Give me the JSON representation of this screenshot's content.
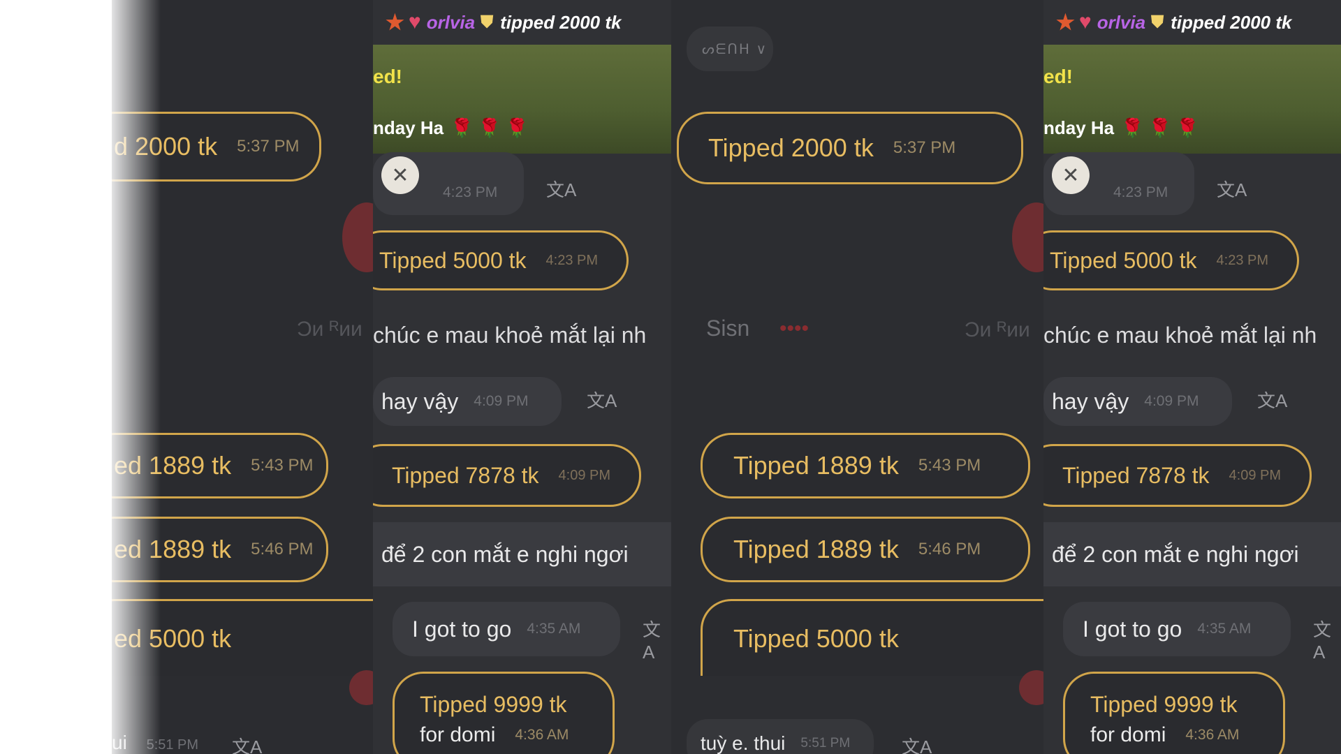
{
  "banner": {
    "name": "orlvia",
    "action": "tipped 2000 tk"
  },
  "green": {
    "line1": "ed!",
    "line2": "nday Ha",
    "roses": "🌹 🌹 🌹"
  },
  "chip": "ᔕᗴᑎᕼ ∨",
  "ghost": {
    "left": "Ɔᴎ ᴿᴎᴎ",
    "sisn": "Sisn",
    "red": "••••"
  },
  "avatar_time": "4:23 PM",
  "messages": {
    "tip2000": {
      "text": "Tipped 2000 tk",
      "partial": "d 2000 tk",
      "time": "5:37 PM"
    },
    "tip5000a": {
      "text": "Tipped 5000 tk",
      "time": "4:23 PM"
    },
    "chuc": "chúc e mau khoẻ mắt lại nh",
    "hayvay": {
      "text": "hay vậy",
      "time": "4:09 PM"
    },
    "tip7878": {
      "text": "Tipped 7878 tk",
      "time": "4:09 PM"
    },
    "tip1889a": {
      "text": "Tipped 1889 tk",
      "partial": "ed 1889 tk",
      "time": "5:43 PM"
    },
    "tip1889b": {
      "text": "Tipped 1889 tk",
      "partial": "ed 1889 tk",
      "time": "5:46 PM"
    },
    "de2": "để 2 con mắt e nghi ngơi",
    "tip5000b": {
      "text": "Tipped 5000 tk",
      "partial": "ed 5000 tk"
    },
    "igot": {
      "text": "I got to go",
      "time": "4:35 AM"
    },
    "tip9999": {
      "line1": "Tipped 9999 tk",
      "line2": "for domi",
      "time": "4:36 AM"
    },
    "tuye": {
      "text": "tuỳ e. thui",
      "partial": "ui",
      "time": "5:51 PM"
    }
  },
  "icons": {
    "translate": "translate-icon",
    "star": "star-badge-icon",
    "heart": "heart-badge-icon",
    "shield": "shield-badge-icon"
  },
  "colors": {
    "tip_border": "#d1a54a",
    "tip_text": "#e8bd62",
    "name": "#b864e6",
    "bg": "#303135"
  }
}
